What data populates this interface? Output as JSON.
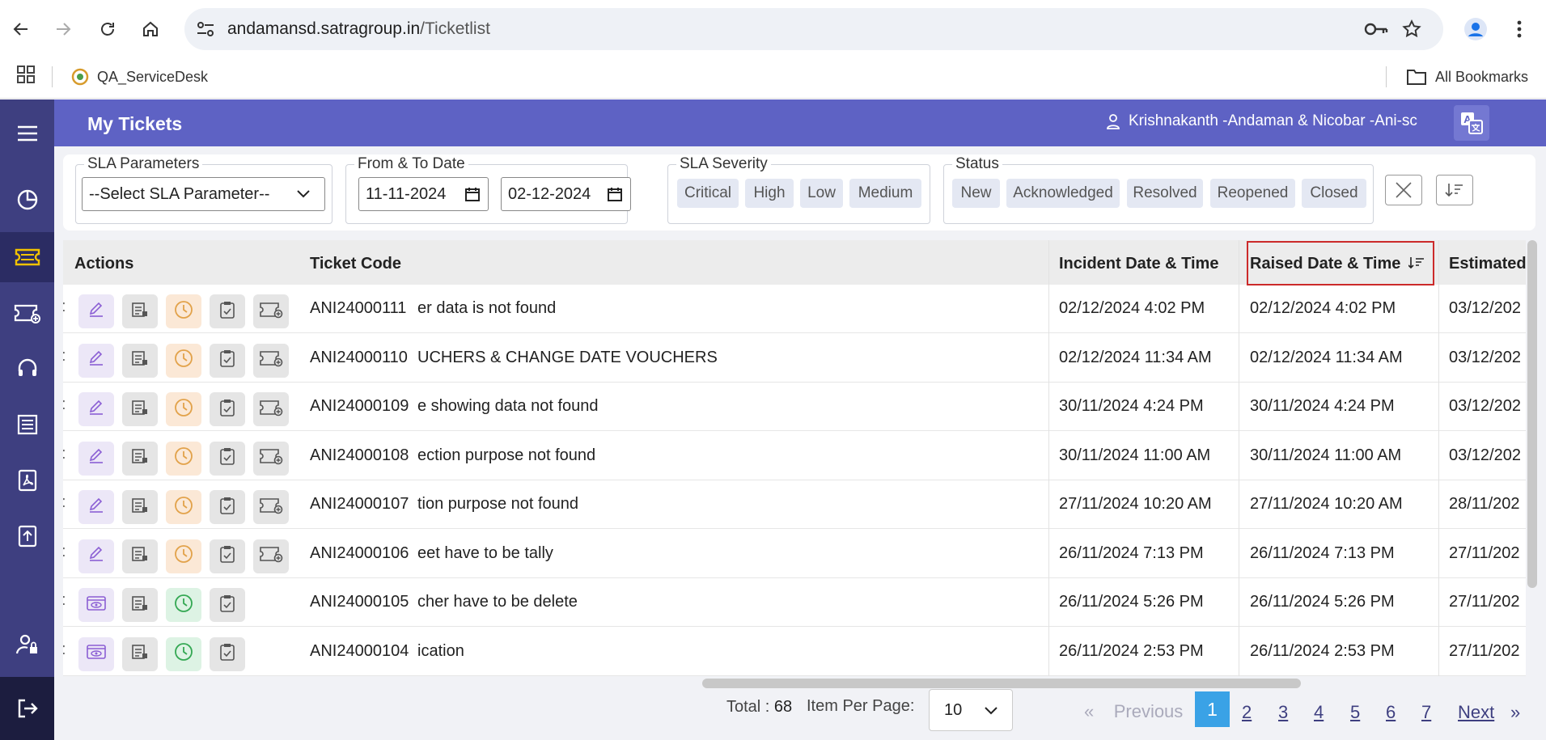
{
  "browser": {
    "url_host": "andamansd.satragroup.in",
    "url_path": "/Ticketlist",
    "bookmark": "QA_ServiceDesk",
    "all_bookmarks": "All Bookmarks"
  },
  "header": {
    "title": "My Tickets",
    "user": "Krishnakanth -Andaman & Nicobar -Ani-sc"
  },
  "filters": {
    "sla_parameters": {
      "legend": "SLA Parameters",
      "value": "--Select SLA Parameter--"
    },
    "date": {
      "legend": "From & To Date",
      "from": "11-11-2024",
      "to": "02-12-2024"
    },
    "sla_severity": {
      "legend": "SLA Severity",
      "chips": [
        "Critical",
        "High",
        "Low",
        "Medium"
      ]
    },
    "status": {
      "legend": "Status",
      "chips": [
        "New",
        "Acknowledged",
        "Resolved",
        "Reopened",
        "Closed"
      ]
    }
  },
  "table": {
    "columns": [
      "Actions",
      "Ticket Code",
      "Incident Date & Time",
      "Raised Date & Time",
      "Estimated"
    ],
    "rows": [
      {
        "code": "ANI24000111",
        "desc": "er data is not found",
        "incident": "02/12/2024 4:02 PM",
        "raised": "02/12/2024 4:02 PM",
        "estimated": "03/12/202",
        "mode": "edit"
      },
      {
        "code": "ANI24000110",
        "desc": "UCHERS & CHANGE DATE VOUCHERS",
        "incident": "02/12/2024 11:34 AM",
        "raised": "02/12/2024 11:34 AM",
        "estimated": "03/12/202",
        "mode": "edit"
      },
      {
        "code": "ANI24000109",
        "desc": "e showing data not found",
        "incident": "30/11/2024 4:24 PM",
        "raised": "30/11/2024 4:24 PM",
        "estimated": "03/12/202",
        "mode": "edit"
      },
      {
        "code": "ANI24000108",
        "desc": "ection purpose not found",
        "incident": "30/11/2024 11:00 AM",
        "raised": "30/11/2024 11:00 AM",
        "estimated": "03/12/202",
        "mode": "edit"
      },
      {
        "code": "ANI24000107",
        "desc": "tion purpose not found",
        "incident": "27/11/2024 10:20 AM",
        "raised": "27/11/2024 10:20 AM",
        "estimated": "28/11/202",
        "mode": "edit"
      },
      {
        "code": "ANI24000106",
        "desc": "eet have to be tally",
        "incident": "26/11/2024 7:13 PM",
        "raised": "26/11/2024 7:13 PM",
        "estimated": "27/11/202",
        "mode": "edit"
      },
      {
        "code": "ANI24000105",
        "desc": "cher have to be delete",
        "incident": "26/11/2024 5:26 PM",
        "raised": "26/11/2024 5:26 PM",
        "estimated": "27/11/202",
        "mode": "view"
      },
      {
        "code": "ANI24000104",
        "desc": "ication",
        "incident": "26/11/2024 2:53 PM",
        "raised": "26/11/2024 2:53 PM",
        "estimated": "27/11/202",
        "mode": "view"
      }
    ]
  },
  "pagination": {
    "total_label": "Total :",
    "total": "68",
    "per_page_label": "Item Per Page:",
    "per_page": "10",
    "first_glyph": "«",
    "previous": "Previous",
    "pages": [
      "1",
      "2",
      "3",
      "4",
      "5",
      "6",
      "7"
    ],
    "next": "Next",
    "last_glyph": "»"
  },
  "colors": {
    "sidebar": "#3e3f80",
    "header": "#5e62c4",
    "active_page": "#3aa2e6",
    "highlight_frame": "#cc2a2a"
  }
}
